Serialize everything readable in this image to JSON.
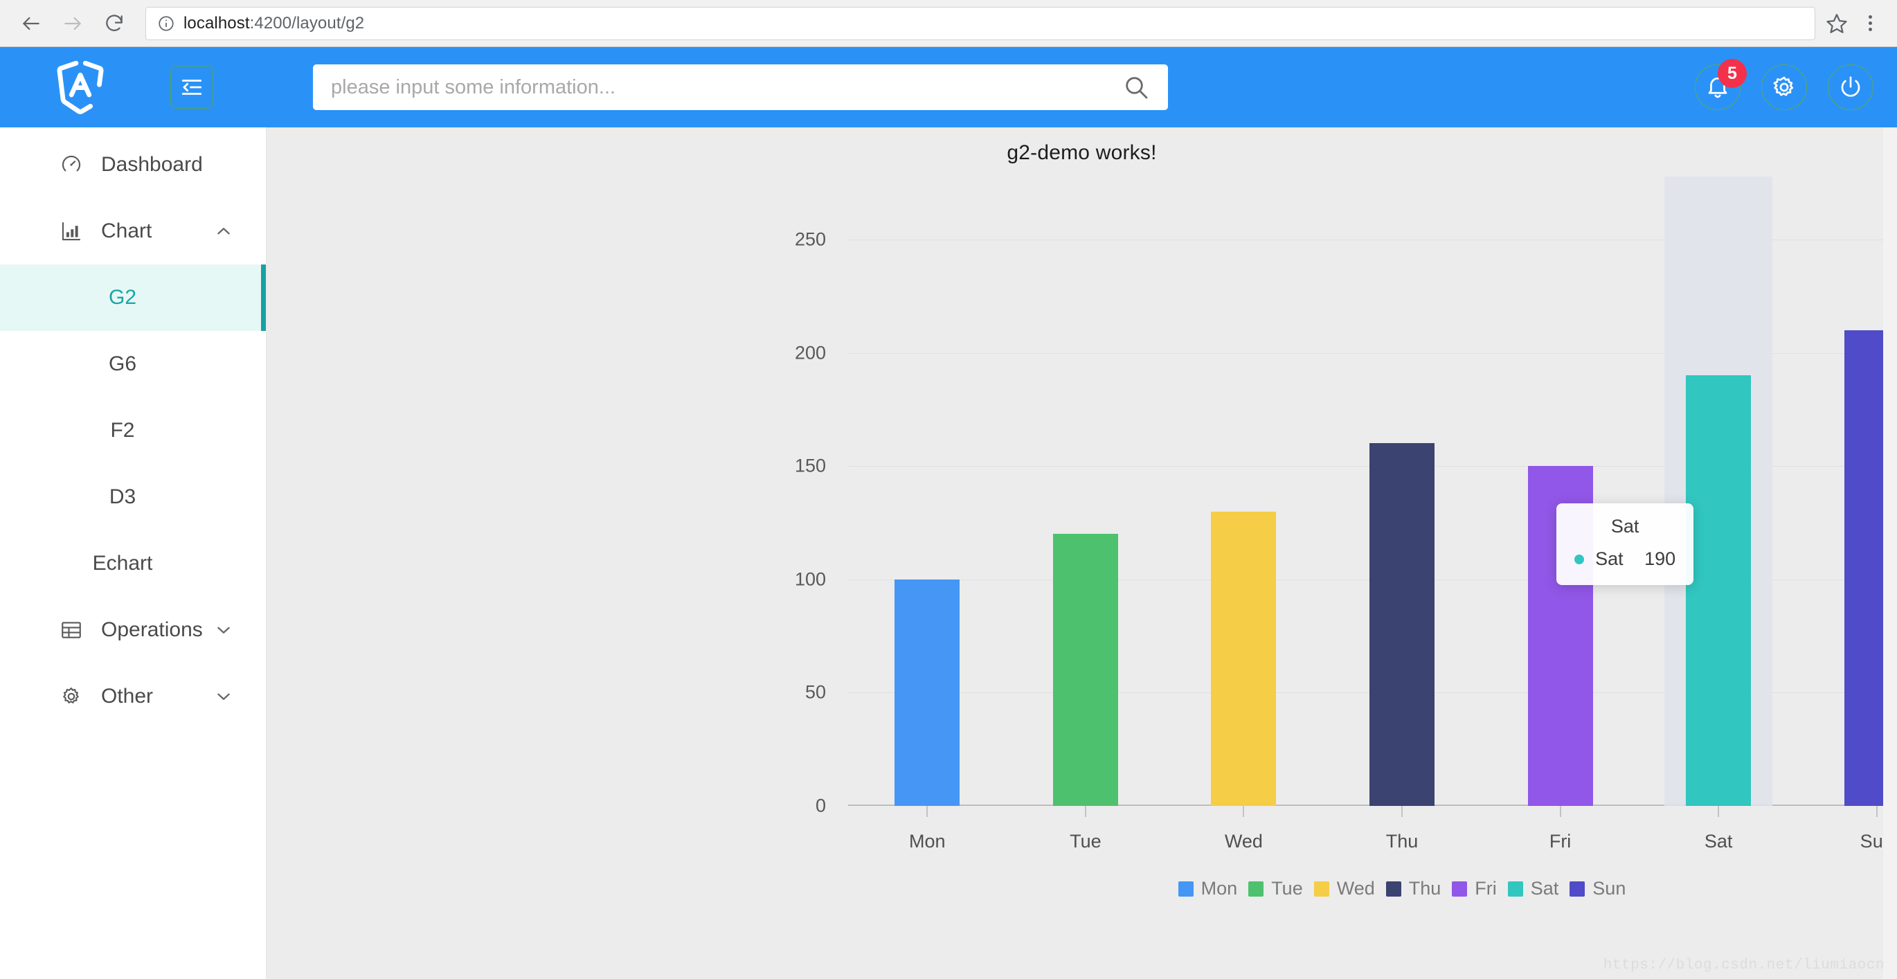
{
  "browser": {
    "back_label": "Back",
    "forward_label": "Forward",
    "reload_label": "Reload",
    "url_scheme_label": "Site information",
    "url_host": "localhost",
    "url_path": ":4200/layout/g2",
    "bookmark_label": "Bookmark this page",
    "menu_label": "Customize and control"
  },
  "header": {
    "logo_label": "Angular",
    "collapse_label": "Collapse menu",
    "accent_color": "#2a92f7",
    "search": {
      "placeholder": "please input some information...",
      "value": "",
      "search_label": "Search"
    },
    "notifications": {
      "label": "Notifications",
      "badge": "5",
      "badge_color": "#f4314a"
    },
    "settings_label": "Settings",
    "power_label": "Logout"
  },
  "sidebar": {
    "active_color": "#17a2a2",
    "items": [
      {
        "label": "Dashboard",
        "icon": "dashboard-icon",
        "type": "link"
      },
      {
        "label": "Chart",
        "icon": "bar-chart-icon",
        "type": "group",
        "expanded": true,
        "chevron": "chevron-up"
      },
      {
        "label": "Operations",
        "icon": "table-icon",
        "type": "group",
        "expanded": false,
        "chevron": "chevron-down"
      },
      {
        "label": "Other",
        "icon": "gear-icon",
        "type": "group",
        "expanded": false,
        "chevron": "chevron-down"
      }
    ],
    "chart_children": [
      {
        "label": "G2",
        "active": true
      },
      {
        "label": "G6",
        "active": false
      },
      {
        "label": "F2",
        "active": false
      },
      {
        "label": "D3",
        "active": false
      },
      {
        "label": "Echart",
        "active": false
      }
    ]
  },
  "main": {
    "title": "g2-demo works!",
    "watermark": "https://blog.csdn.net/liumiaocn"
  },
  "chart_data": {
    "type": "bar",
    "title": "g2-demo works!",
    "xlabel": "",
    "ylabel": "",
    "categories": [
      "Mon",
      "Tue",
      "Wed",
      "Thu",
      "Fri",
      "Sat",
      "Sun"
    ],
    "values": [
      100,
      120,
      130,
      160,
      150,
      190,
      210
    ],
    "colors": [
      "#4596f5",
      "#4ec16e",
      "#f5cd46",
      "#3b4371",
      "#9157e8",
      "#31c6c0",
      "#4f4bc9"
    ],
    "ylim": [
      0,
      250
    ],
    "yticks": [
      0,
      50,
      100,
      150,
      200,
      250
    ],
    "ytick_labels": [
      "0",
      "50",
      "100",
      "150",
      "200",
      "250"
    ],
    "grid": true,
    "legend_position": "bottom",
    "legend": [
      "Mon",
      "Tue",
      "Wed",
      "Thu",
      "Fri",
      "Sat",
      "Sun"
    ],
    "highlighted_category": "Sat",
    "tooltip": {
      "title": "Sat",
      "name": "Sat",
      "value": "190",
      "dot_color": "#31c6c0"
    }
  }
}
